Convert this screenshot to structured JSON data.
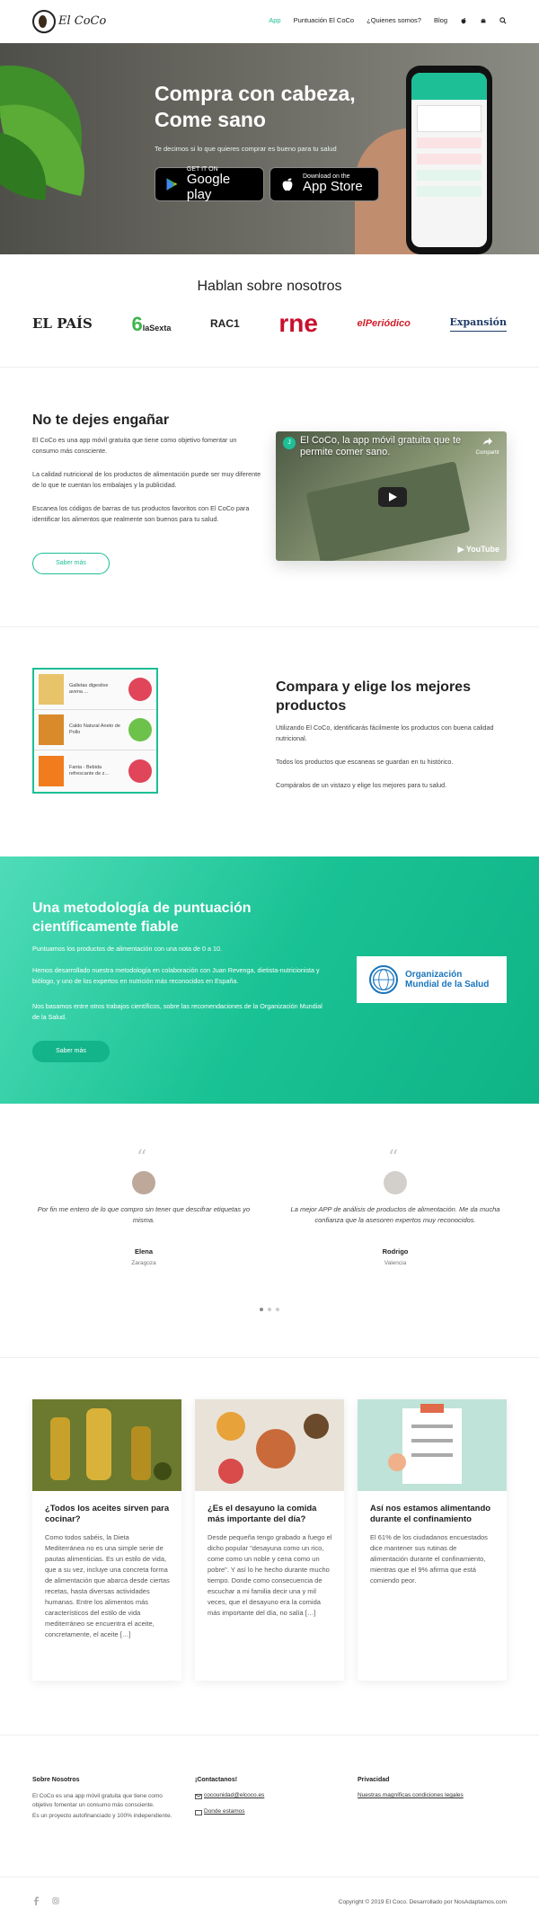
{
  "header": {
    "logo_text": "El CoCo",
    "nav": [
      "App",
      "Puntuación El CoCo",
      "¿Quienes somos?",
      "Blog"
    ],
    "icons": [
      "apple-icon",
      "android-icon",
      "search-icon"
    ]
  },
  "hero": {
    "title_line1": "Compra con cabeza,",
    "title_line2": "Come sano",
    "subtitle": "Te decimos si lo que quieres comprar es bueno para tu salud",
    "google": {
      "small": "GET IT ON",
      "big": "Google play"
    },
    "apple": {
      "small": "Download on the",
      "big": "App Store"
    }
  },
  "press": {
    "title": "Hablan sobre nosotros",
    "logos": [
      "EL PAÍS",
      "laSexta",
      "RAC1",
      "rne",
      "elPeriódico",
      "Expansión"
    ]
  },
  "intro": {
    "title": "No te dejes engañar",
    "p1": "El CoCo es una app móvil gratuita que tiene como objetivo fomentar un consumo más consciente.",
    "p2": "La calidad nutricional de los productos de alimentación puede ser muy diferente de lo que te cuentan los embalajes y la publicidad.",
    "p3": "Escanea los códigos de barras de tus productos favoritos con El CoCo para identificar los alimentos que realmente son buenos para tu salud.",
    "button": "Saber más",
    "video_title": "El CoCo, la app móvil gratuita que te permite comer sano.",
    "video_share": "Compartir",
    "video_brand": "YouTube"
  },
  "compare": {
    "title": "Compara y elige los mejores productos",
    "p1": "Utilizando El CoCo, identificarás fácilmente los productos con buena calidad nutricional.",
    "p2": "Todos los productos que escaneas se guardan en tu histórico.",
    "p3": "Compáralos de un vistazo y elige los mejores para tu salud.",
    "products": [
      {
        "name": "Galletas digestive avena ...",
        "color": "#e0455a"
      },
      {
        "name": "Caldo Natural Aneto de Pollo",
        "color": "#6cc24a"
      },
      {
        "name": "Fanta - Bebida refrescante de z...",
        "color": "#e0455a"
      }
    ]
  },
  "method": {
    "title": "Una metodología de puntuación científicamente fiable",
    "p1": "Puntuamos los productos de alimentación con una nota de 0 a 10.",
    "p2": "Hemos desarrollado nuestra metodología en colaboración con Juan Revenga, dietista-nutricionista y biólogo, y uno de los expertos en nutrición más reconocidos en España.",
    "p3": "Nos basamos entre otros trabajos científicos, sobre las recomendaciones de la Organización Mundial de la Salud.",
    "who_line1": "Organización",
    "who_line2": "Mundial de la Salud",
    "button": "Saber más"
  },
  "testimonials": [
    {
      "quote": "Por fin me entero de lo que compro sin tener que descifrar etiquetas yo misma.",
      "name": "Elena",
      "city": "Zaragoza"
    },
    {
      "quote": "La mejor APP de análisis de productos de alimentación. Me da mucha confianza que la asesoren expertos muy reconocidos.",
      "name": "Rodrigo",
      "city": "Valencia"
    }
  ],
  "blog": [
    {
      "title": "¿Todos los aceites sirven para cocinar?",
      "text": "Como todos sabéis, la Dieta Mediterránea no es una simple serie de pautas alimenticias. Es un estilo de vida, que a su vez, incluye una concreta forma de alimentación que abarca desde ciertas recetas, hasta diversas actividades humanas. Entre los alimentos más característicos del estilo de vida mediterráneo se encuentra el aceite, concretamente, el aceite […]"
    },
    {
      "title": "¿Es el desayuno la comida más importante del día?",
      "text": "Desde pequeña tengo grabado a fuego el dicho popular \"desayuna como un rico, come como un noble y cena como un pobre\". Y así lo he hecho durante mucho tiempo. Donde como consecuencia de escuchar a mi familia decir una y mil veces, que el desayuno era la comida más importante del día, no salía […]"
    },
    {
      "title": "Así nos estamos alimentando durante el confinamiento",
      "text": "El 61% de los ciudadanos encuestados dice mantener sus rutinas de alimentación durante el confinamiento, mientras que el 9% afirma que está comiendo peor."
    }
  ],
  "footer": {
    "about_title": "Sobre Nosotros",
    "about_text": "El CoCo es una app móvil gratuita que tiene como objetivo fomentar un consumo más consciente.",
    "about_text2": "Es un proyecto autofinanciado y 100% independiente.",
    "contact_title": "¡Contactanos!",
    "contact_email": "cocounidad@elcoco.es",
    "contact_where": "Donde estamos",
    "privacy_title": "Privacidad",
    "privacy_link": "Nuestras magníficas condiciones legales",
    "copyright": "Copyright © 2019 El Coco. Desarrollado por NosAdaptamos.com"
  }
}
